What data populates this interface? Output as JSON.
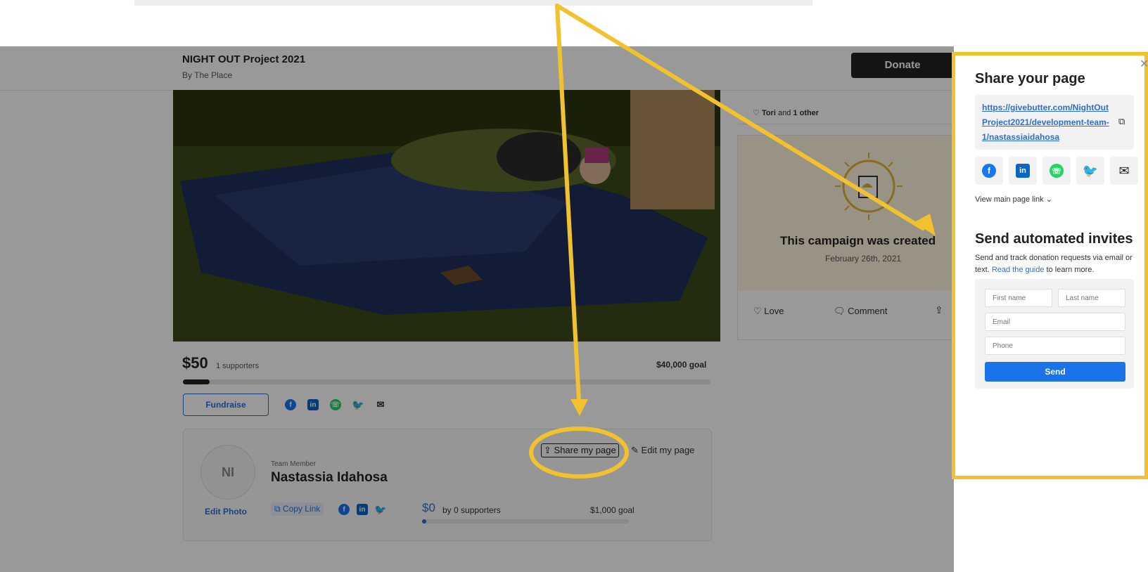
{
  "header": {
    "campaign_title": "NIGHT OUT Project 2021",
    "campaign_by": "By The Place",
    "donate_label": "Donate"
  },
  "campaign": {
    "raised": "$50",
    "supporters": "1 supporters",
    "goal": "$40,000 goal",
    "progress_fraction": 0.05,
    "fundraise_label": "Fundraise"
  },
  "member": {
    "initials": "NI",
    "edit_photo": "Edit Photo",
    "role": "Team Member",
    "name": "Nastassia Idahosa",
    "share_my_page": "Share my page",
    "edit_my_page": "Edit my page",
    "copy_link": "Copy Link",
    "raised": "$0",
    "supporters": "by 0 supporters",
    "goal": "$1,000 goal",
    "progress_fraction": 0.02
  },
  "feed": {
    "likes_name": "Tori",
    "likes_and": "and",
    "likes_other": "1 other",
    "created_title": "This campaign was created",
    "created_date": "February 26th, 2021",
    "love_label": "Love",
    "comment_label": "Comment"
  },
  "share_modal": {
    "title": "Share your page",
    "link": "https://givebutter.com/NightOutProject2021/development-team-1/nastassiaidahosa",
    "view_main_link": "View main page link",
    "invites_title": "Send automated invites",
    "invites_desc_1": "Send and track donation requests via email or text.",
    "invites_link": "Read the guide",
    "invites_desc_2": "to learn more.",
    "first_name_placeholder": "First name",
    "last_name_placeholder": "Last name",
    "email_placeholder": "Email",
    "phone_placeholder": "Phone",
    "send_label": "Send"
  },
  "colors": {
    "brand_blue": "#2b6fd6",
    "send_blue": "#1a73e8",
    "annotation_yellow": "#f2c12e",
    "facebook": "#1877f2",
    "linkedin": "#0a66c2",
    "whatsapp": "#25d366",
    "twitter": "#1da1f2"
  },
  "icons": [
    "facebook-icon",
    "linkedin-icon",
    "whatsapp-icon",
    "twitter-icon",
    "mail-icon",
    "copy-icon",
    "close-icon",
    "heart-icon",
    "comment-icon",
    "share-icon",
    "edit-icon",
    "chevron-down-icon"
  ]
}
